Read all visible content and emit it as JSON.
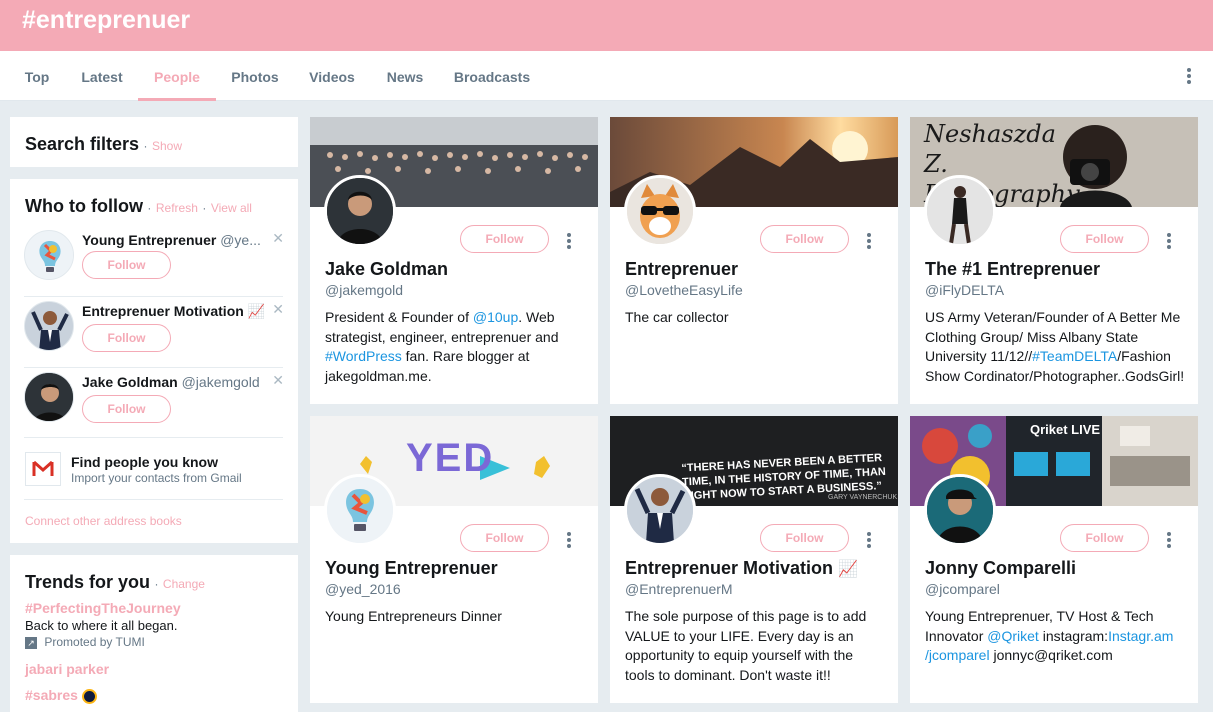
{
  "header": {
    "title": "#entreprenuer"
  },
  "tabs": [
    "Top",
    "Latest",
    "People",
    "Photos",
    "Videos",
    "News",
    "Broadcasts"
  ],
  "active_tab": "People",
  "search_filters": {
    "title": "Search filters",
    "toggle": "Show"
  },
  "who_to_follow": {
    "title": "Who to follow",
    "refresh": "Refresh",
    "view_all": "View all",
    "follow_label": "Follow",
    "users": [
      {
        "name": "Young Entreprenuer",
        "handle": "@ye..."
      },
      {
        "name": "Entreprenuer Motivation",
        "handle": ""
      },
      {
        "name": "Jake Goldman",
        "handle": "@jakemgold"
      }
    ],
    "find_people": {
      "title": "Find people you know",
      "subtitle": "Import your contacts from Gmail"
    },
    "connect": "Connect other address books"
  },
  "trends": {
    "title": "Trends for you",
    "change": "Change",
    "items": [
      {
        "tag": "#PerfectingTheJourney",
        "desc": "Back to where it all began.",
        "promoted": "Promoted by TUMI"
      },
      {
        "tag": "jabari parker"
      },
      {
        "tag": "#sabres"
      }
    ]
  },
  "people": [
    {
      "name": "Jake Goldman",
      "handle": "@jakemgold",
      "follow": "Follow",
      "bio": {
        "t1": "President & Founder of ",
        "l1": "@10up",
        "t2": ". Web strategist, engineer, entreprenuer and ",
        "l2": "#WordPress",
        "t3": " fan. Rare blogger at jakegoldman.me."
      }
    },
    {
      "name": "Entreprenuer",
      "handle": "@LovetheEasyLife",
      "follow": "Follow",
      "bio": "The car collector"
    },
    {
      "name": "The #1 Entreprenuer",
      "handle": "@iFlyDELTA",
      "follow": "Follow",
      "banner_text": "Neshaszda Z. Photography",
      "bio": {
        "t1": "US Army Veteran/Founder of A Better Me Clothing Group/ Miss Albany State University 11/12//",
        "l1": "#TeamDELTA",
        "t2": "/Fashion Show Cordinator/Photographer..GodsGirl!"
      }
    },
    {
      "name": "Young Entreprenuer",
      "handle": "@yed_2016",
      "follow": "Follow",
      "bio": "Young Entrepreneurs Dinner",
      "banner_text": "YED"
    },
    {
      "name": "Entreprenuer Motivation",
      "handle": "@EntreprenuerM",
      "follow": "Follow",
      "banner_quote": "“THERE HAS NEVER BEEN A BETTER TIME, IN THE HISTORY OF TIME, THAN RIGHT NOW TO START A BUSINESS.”",
      "banner_author": "GARY VAYNERCHUK",
      "bio": "The sole purpose of this page is to add VALUE to your LIFE. Every day is an opportunity to equip yourself with the tools to dominant. Don't waste it!!"
    },
    {
      "name": "Jonny Comparelli",
      "handle": "@jcomparel",
      "follow": "Follow",
      "banner_text": "Qriket LIVE",
      "bio": {
        "t1": "Young Entreprenuer, TV Host & Tech Innovator ",
        "l1": "@Qriket",
        "t2": " instagram:",
        "l2": "Instagr.am /jcomparel",
        "t3": " jonnyc@qriket.com"
      }
    }
  ]
}
